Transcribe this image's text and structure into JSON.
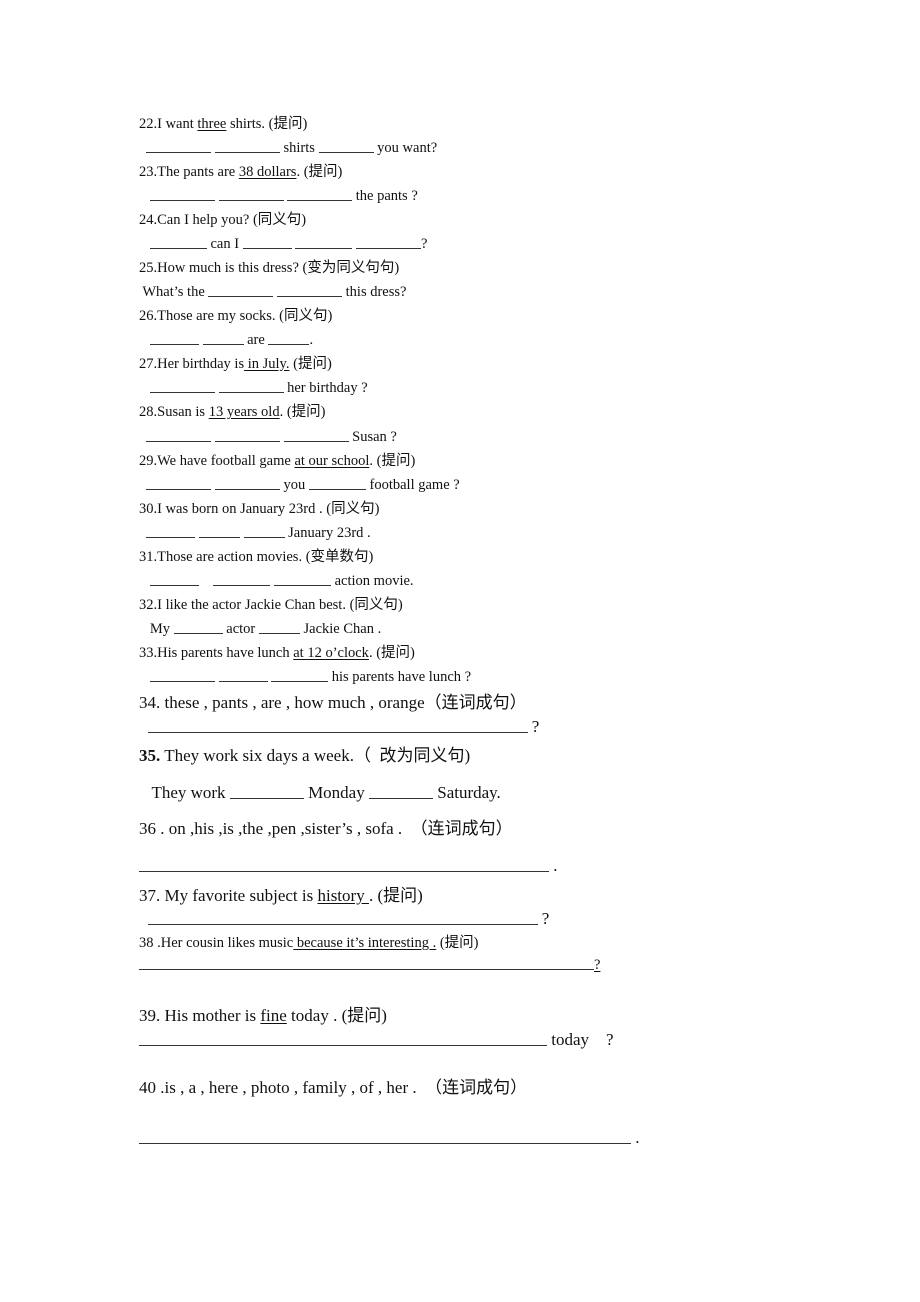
{
  "worksheet": {
    "questions": [
      {
        "number": "22",
        "prompt": [
          {
            "t": "22.I want "
          },
          {
            "t": "three",
            "u": true
          },
          {
            "t": " shirts. (提问)"
          }
        ],
        "answer": [
          {
            "t": "  "
          },
          {
            "blank": 65
          },
          {
            "t": " "
          },
          {
            "blank": 65
          },
          {
            "t": " shirts "
          },
          {
            "blank": 55
          },
          {
            "t": " you want?"
          }
        ]
      },
      {
        "number": "23",
        "prompt": [
          {
            "t": "23.The pants are "
          },
          {
            "t": "38 dollars",
            "u": true
          },
          {
            "t": ". (提问)"
          }
        ],
        "answer": [
          {
            "t": "   "
          },
          {
            "blank": 65
          },
          {
            "t": " "
          },
          {
            "blank": 65
          },
          {
            "t": " "
          },
          {
            "blank": 65
          },
          {
            "t": " the pants ?"
          }
        ]
      },
      {
        "number": "24",
        "prompt": [
          {
            "t": "24.Can I help you? (同义句)"
          }
        ],
        "answer": [
          {
            "t": "   "
          },
          {
            "blank": 57
          },
          {
            "t": " can I "
          },
          {
            "blank": 49
          },
          {
            "t": " "
          },
          {
            "blank": 57
          },
          {
            "t": " "
          },
          {
            "blank": 65
          },
          {
            "t": "?"
          }
        ]
      },
      {
        "number": "25",
        "prompt": [
          {
            "t": "25.How much is this dress? (变为同义句句)"
          }
        ],
        "answer": [
          {
            "t": " What’s the "
          },
          {
            "blank": 65
          },
          {
            "t": " "
          },
          {
            "blank": 65
          },
          {
            "t": " this dress?"
          }
        ]
      },
      {
        "number": "26",
        "prompt": [
          {
            "t": "26.Those are my socks. (同义句)"
          }
        ],
        "answer": [
          {
            "t": "   "
          },
          {
            "blank": 49
          },
          {
            "t": " "
          },
          {
            "blank": 41
          },
          {
            "t": " are "
          },
          {
            "blank": 41
          },
          {
            "t": "."
          }
        ]
      },
      {
        "number": "27",
        "prompt": [
          {
            "t": "27.Her birthday is"
          },
          {
            "t": " in July.",
            "u": true
          },
          {
            "t": " (提问)"
          }
        ],
        "answer": [
          {
            "t": "   "
          },
          {
            "blank": 65
          },
          {
            "t": " "
          },
          {
            "blank": 65
          },
          {
            "t": " her birthday ?"
          }
        ]
      },
      {
        "number": "28",
        "prompt": [
          {
            "t": "28.Susan is "
          },
          {
            "t": "13 years old",
            "u": true
          },
          {
            "t": ". (提问)"
          }
        ],
        "answer": [
          {
            "t": "  "
          },
          {
            "blank": 65
          },
          {
            "t": " "
          },
          {
            "blank": 65
          },
          {
            "t": " "
          },
          {
            "blank": 65
          },
          {
            "t": " Susan ?"
          }
        ]
      },
      {
        "number": "29",
        "prompt": [
          {
            "t": "29.We have football game "
          },
          {
            "t": "at our school",
            "u": true
          },
          {
            "t": ". (提问)"
          }
        ],
        "answer": [
          {
            "t": "  "
          },
          {
            "blank": 65
          },
          {
            "t": " "
          },
          {
            "blank": 65
          },
          {
            "t": " you "
          },
          {
            "blank": 57
          },
          {
            "t": " football game ?"
          }
        ]
      },
      {
        "number": "30",
        "prompt": [
          {
            "t": "30.I was born on January 23rd . (同义句)"
          }
        ],
        "answer": [
          {
            "t": "  "
          },
          {
            "blank": 49
          },
          {
            "t": " "
          },
          {
            "blank": 41
          },
          {
            "t": " "
          },
          {
            "blank": 41
          },
          {
            "t": " January 23rd ."
          }
        ]
      },
      {
        "number": "31",
        "prompt": [
          {
            "t": "31.Those are action movies. (变单数句)"
          }
        ],
        "answer": [
          {
            "t": "   "
          },
          {
            "blank": 49
          },
          {
            "t": "    "
          },
          {
            "blank": 57
          },
          {
            "t": " "
          },
          {
            "blank": 57
          },
          {
            "t": " action movie."
          }
        ]
      },
      {
        "number": "32",
        "prompt": [
          {
            "t": "32.I like the actor Jackie Chan best. (同义句)"
          }
        ],
        "answer": [
          {
            "t": "   My "
          },
          {
            "blank": 49
          },
          {
            "t": " actor "
          },
          {
            "blank": 41
          },
          {
            "t": " Jackie Chan ."
          }
        ]
      },
      {
        "number": "33",
        "prompt": [
          {
            "t": "33.His parents have lunch "
          },
          {
            "t": "at 12 o’clock",
            "u": true
          },
          {
            "t": ". (提问)"
          }
        ],
        "answer": [
          {
            "t": "   "
          },
          {
            "blank": 65
          },
          {
            "t": " "
          },
          {
            "blank": 49
          },
          {
            "t": " "
          },
          {
            "blank": 57
          },
          {
            "t": " his parents have lunch ?"
          }
        ]
      },
      {
        "number": "34",
        "prompt": [
          {
            "t": "34. these , pants , are , how much , orange（连词成句）"
          }
        ],
        "answer": [
          {
            "t": "  "
          },
          {
            "blank": 380
          },
          {
            "t": " ?"
          }
        ]
      },
      {
        "number": "35",
        "prompt": [
          {
            "t": "35.",
            "b": true
          },
          {
            "t": " They work six days a week.（  改为同义句)"
          }
        ],
        "answer": [
          {
            "t": "   They work "
          },
          {
            "blank": 74
          },
          {
            "t": " Monday "
          },
          {
            "blank": 64
          },
          {
            "t": " Saturday."
          }
        ]
      },
      {
        "number": "36",
        "prompt": [
          {
            "t": "36 . on ,his ,is ,the ,pen ,sister’s , sofa .  （连词成句）"
          }
        ],
        "answer": [
          {
            "blank": 410
          },
          {
            "t": " ."
          }
        ]
      },
      {
        "number": "37",
        "prompt": [
          {
            "t": "37. My favorite subject is "
          },
          {
            "t": "history ",
            "u": true
          },
          {
            "t": ". (提问)"
          }
        ],
        "answer": [
          {
            "t": "  "
          },
          {
            "blank": 390
          },
          {
            "t": " ?"
          }
        ]
      },
      {
        "number": "38",
        "prompt": [
          {
            "t": "38 .Her cousin likes music"
          },
          {
            "t": " because it’s interesting .",
            "u": true
          },
          {
            "t": " (提问)"
          }
        ],
        "answer": [
          {
            "blank": 455
          },
          {
            "t": "?",
            "u": true
          }
        ]
      },
      {
        "number": "39",
        "prompt": [
          {
            "t": "39. His mother is "
          },
          {
            "t": "fine",
            "u": true
          },
          {
            "t": " today . (提问)"
          }
        ],
        "answer": [
          {
            "blank": 408
          },
          {
            "t": " today    ?"
          }
        ]
      },
      {
        "number": "40",
        "prompt": [
          {
            "t": "40 .is , a , here , photo , family , of , her .  （连词成句）"
          }
        ],
        "answer": [
          {
            "blank": 492
          },
          {
            "t": " ."
          }
        ]
      }
    ]
  }
}
